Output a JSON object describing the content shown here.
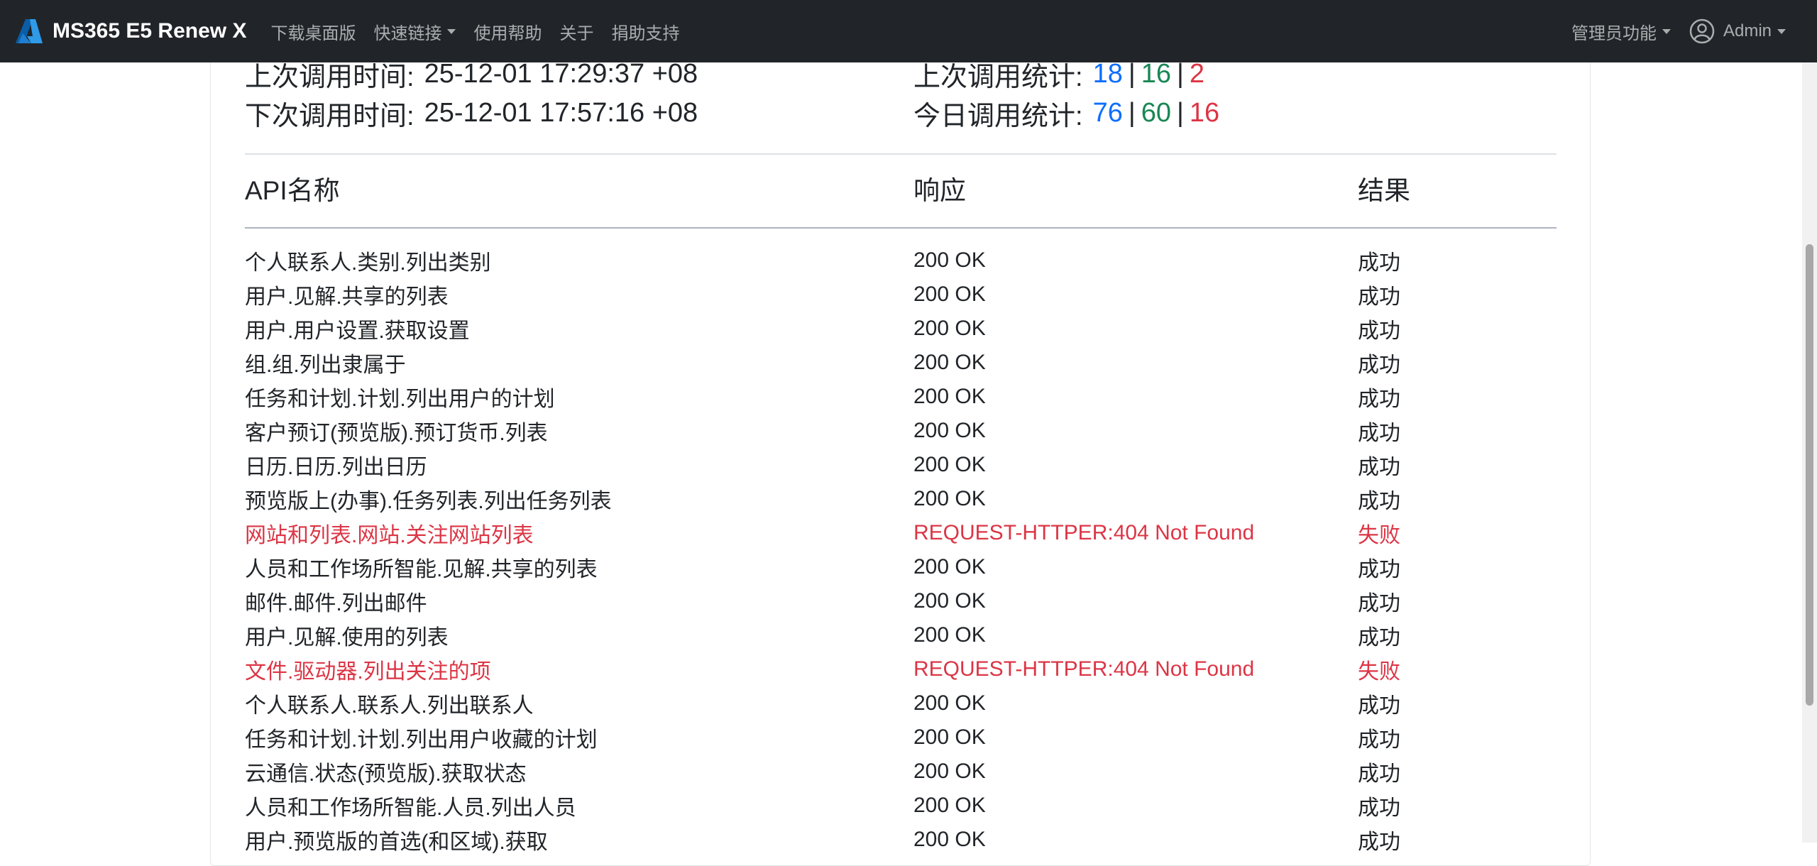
{
  "navbar": {
    "brand": "MS365 E5 Renew X",
    "links": [
      "下载桌面版",
      "快速链接",
      "使用帮助",
      "关于",
      "捐助支持"
    ],
    "admin_menu": "管理员功能",
    "user": "Admin",
    "colors": {
      "background": "#212529",
      "brand_accent": "#0078d4"
    }
  },
  "stats": {
    "last_call_label": "上次调用时间:",
    "last_call_value": "25-12-01 17:29:37 +08",
    "next_call_label": "下次调用时间:",
    "next_call_value": "25-12-01 17:57:16 +08",
    "last_stats_label": "上次调用统计:",
    "last_stats": {
      "total": "18",
      "success": "16",
      "fail": "2"
    },
    "today_stats_label": "今日调用统计:",
    "today_stats": {
      "total": "76",
      "success": "60",
      "fail": "16"
    },
    "separator": "|"
  },
  "table": {
    "headers": [
      "API名称",
      "响应",
      "结果"
    ],
    "rows": [
      {
        "api": "个人联系人.类别.列出类别",
        "response": "200 OK",
        "result": "成功",
        "status": "ok"
      },
      {
        "api": "用户.见解.共享的列表",
        "response": "200 OK",
        "result": "成功",
        "status": "ok"
      },
      {
        "api": "用户.用户设置.获取设置",
        "response": "200 OK",
        "result": "成功",
        "status": "ok"
      },
      {
        "api": "组.组.列出隶属于",
        "response": "200 OK",
        "result": "成功",
        "status": "ok"
      },
      {
        "api": "任务和计划.计划.列出用户的计划",
        "response": "200 OK",
        "result": "成功",
        "status": "ok"
      },
      {
        "api": "客户预订(预览版).预订货币.列表",
        "response": "200 OK",
        "result": "成功",
        "status": "ok"
      },
      {
        "api": "日历.日历.列出日历",
        "response": "200 OK",
        "result": "成功",
        "status": "ok"
      },
      {
        "api": "预览版上(办事).任务列表.列出任务列表",
        "response": "200 OK",
        "result": "成功",
        "status": "ok"
      },
      {
        "api": "网站和列表.网站.关注网站列表",
        "response": "REQUEST-HTTPER:404 Not Found",
        "result": "失败",
        "status": "fail"
      },
      {
        "api": "人员和工作场所智能.见解.共享的列表",
        "response": "200 OK",
        "result": "成功",
        "status": "ok"
      },
      {
        "api": "邮件.邮件.列出邮件",
        "response": "200 OK",
        "result": "成功",
        "status": "ok"
      },
      {
        "api": "用户.见解.使用的列表",
        "response": "200 OK",
        "result": "成功",
        "status": "ok"
      },
      {
        "api": "文件.驱动器.列出关注的项",
        "response": "REQUEST-HTTPER:404 Not Found",
        "result": "失败",
        "status": "fail"
      },
      {
        "api": "个人联系人.联系人.列出联系人",
        "response": "200 OK",
        "result": "成功",
        "status": "ok"
      },
      {
        "api": "任务和计划.计划.列出用户收藏的计划",
        "response": "200 OK",
        "result": "成功",
        "status": "ok"
      },
      {
        "api": "云通信.状态(预览版).获取状态",
        "response": "200 OK",
        "result": "成功",
        "status": "ok"
      },
      {
        "api": "人员和工作场所智能.人员.列出人员",
        "response": "200 OK",
        "result": "成功",
        "status": "ok"
      },
      {
        "api": "用户.预览版的首选(和区域).获取",
        "response": "200 OK",
        "result": "成功",
        "status": "ok"
      }
    ]
  },
  "colors": {
    "success_count": "#0d6efd",
    "ok_count": "#198754",
    "fail": "#dc3545"
  }
}
